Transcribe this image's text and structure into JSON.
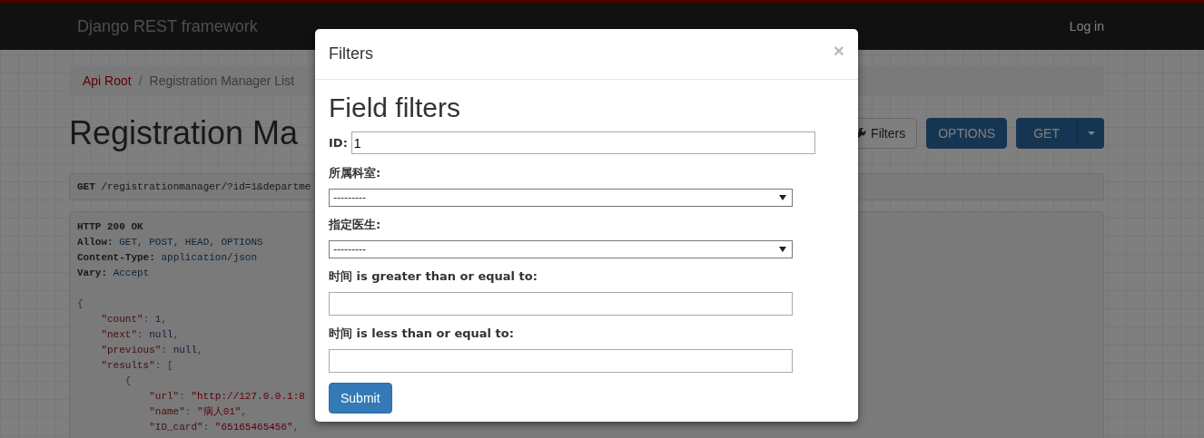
{
  "navbar": {
    "brand": "Django REST framework",
    "login": "Log in"
  },
  "breadcrumb_separator": "/",
  "breadcrumb": [
    {
      "label": "Api Root",
      "selected": false
    },
    {
      "label": "Registration Manager List",
      "selected": true
    }
  ],
  "page_title": "Registration Ma",
  "toolbar": [
    {
      "kind": "filters",
      "label": "Filters"
    },
    {
      "kind": "primary",
      "label": "OPTIONS"
    },
    {
      "kind": "split",
      "label": "GET"
    }
  ],
  "request": {
    "method": "GET",
    "path": "/registrationmanager/?id=1&departme"
  },
  "response": {
    "status": "HTTP 200 OK",
    "headers": [
      {
        "name": "Allow:",
        "value": "GET, POST, HEAD, OPTIONS"
      },
      {
        "name": "Content-Type:",
        "value": "application/json"
      },
      {
        "name": "Vary:",
        "value": "Accept"
      }
    ],
    "body_lines": [
      [
        {
          "kind": "punct",
          "text": "{"
        }
      ],
      [
        {
          "kind": "key",
          "text": "    \"count\""
        },
        {
          "kind": "punct",
          "text": ": "
        },
        {
          "kind": "literal",
          "text": "1"
        },
        {
          "kind": "punct",
          "text": ","
        }
      ],
      [
        {
          "kind": "key",
          "text": "    \"next\""
        },
        {
          "kind": "punct",
          "text": ": "
        },
        {
          "kind": "literal",
          "text": "null"
        },
        {
          "kind": "punct",
          "text": ","
        }
      ],
      [
        {
          "kind": "key",
          "text": "    \"previous\""
        },
        {
          "kind": "punct",
          "text": ": "
        },
        {
          "kind": "literal",
          "text": "null"
        },
        {
          "kind": "punct",
          "text": ","
        }
      ],
      [
        {
          "kind": "key",
          "text": "    \"results\""
        },
        {
          "kind": "punct",
          "text": ": ["
        }
      ],
      [
        {
          "kind": "punct",
          "text": "        {"
        }
      ],
      [
        {
          "kind": "key",
          "text": "            \"url\""
        },
        {
          "kind": "punct",
          "text": ": "
        },
        {
          "kind": "string",
          "text": "\"http://127.0.0.1:8"
        }
      ],
      [
        {
          "kind": "key",
          "text": "            \"name\""
        },
        {
          "kind": "punct",
          "text": ": "
        },
        {
          "kind": "string",
          "text": "\"病人01\""
        },
        {
          "kind": "punct",
          "text": ","
        }
      ],
      [
        {
          "kind": "key",
          "text": "            \"ID_card\""
        },
        {
          "kind": "punct",
          "text": ": "
        },
        {
          "kind": "string",
          "text": "\"65165465456\""
        },
        {
          "kind": "punct",
          "text": ","
        }
      ]
    ]
  },
  "modal": {
    "title": "Filters",
    "close": "×",
    "heading": "Field filters",
    "fields": [
      {
        "kind": "inline-text",
        "label": "ID:",
        "value": "1"
      },
      {
        "kind": "select",
        "label": "所属科室:",
        "value": "---------"
      },
      {
        "kind": "select",
        "label": "指定医生:",
        "value": "---------"
      },
      {
        "kind": "text",
        "label": "时间 is greater than or equal to:"
      },
      {
        "kind": "text",
        "label": "时间 is less than or equal to:"
      }
    ],
    "submit": "Submit"
  }
}
